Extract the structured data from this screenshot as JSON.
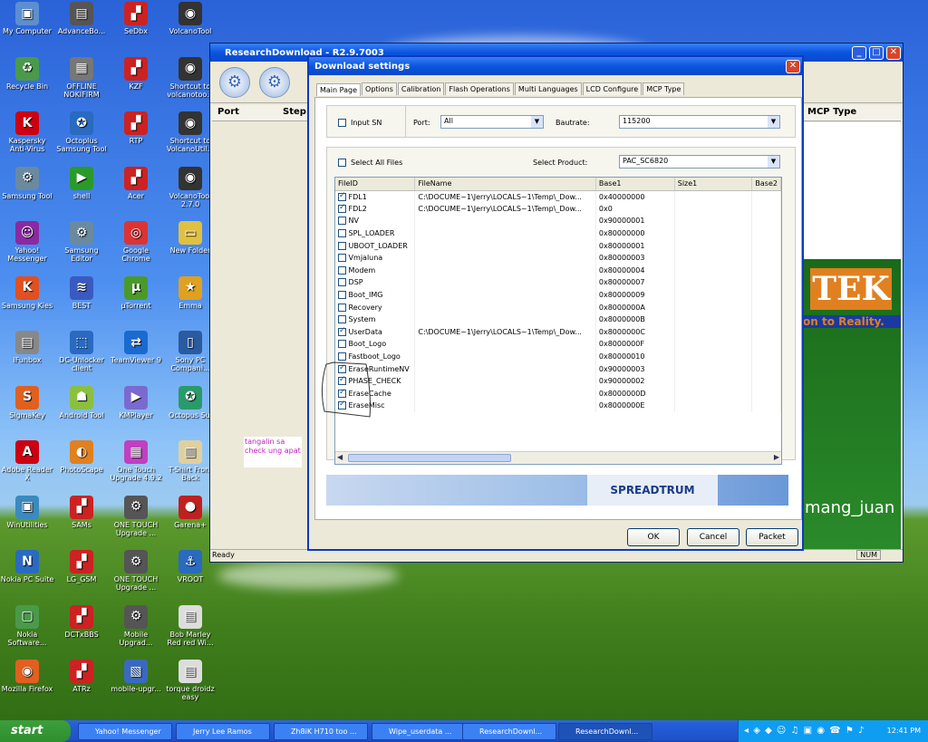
{
  "desktop": {
    "icons": [
      {
        "label": "My Computer",
        "color": "#5b8fd0",
        "glyph": "▣"
      },
      {
        "label": "AdvanceBo...",
        "color": "#555",
        "glyph": "▤"
      },
      {
        "label": "SeDbx",
        "color": "#c22",
        "glyph": "▞"
      },
      {
        "label": "VolcanoTool",
        "color": "#333",
        "glyph": "◉"
      },
      {
        "label": "Recycle Bin",
        "color": "#4a9a4a",
        "glyph": "♻"
      },
      {
        "label": "OFFLINE NOKIFIRM",
        "color": "#777",
        "glyph": "▦"
      },
      {
        "label": "KZF",
        "color": "#c22",
        "glyph": "▞"
      },
      {
        "label": "Shortcut to volcanotoo...",
        "color": "#333",
        "glyph": "◉"
      },
      {
        "label": "Kaspersky Anti-Virus",
        "color": "#c01",
        "glyph": "K"
      },
      {
        "label": "Octoplus Samsung Tool",
        "color": "#2a6ac0",
        "glyph": "✪"
      },
      {
        "label": "RTP",
        "color": "#c22",
        "glyph": "▞"
      },
      {
        "label": "Shortcut to VolcanoUtil...",
        "color": "#333",
        "glyph": "◉"
      },
      {
        "label": "Samsung Tool",
        "color": "#6a8aa0",
        "glyph": "⚙"
      },
      {
        "label": "shell",
        "color": "#2a9a2a",
        "glyph": "▶"
      },
      {
        "label": "Acer",
        "color": "#c22",
        "glyph": "▞"
      },
      {
        "label": "VolcanoTool 2.7.0",
        "color": "#333",
        "glyph": "◉"
      },
      {
        "label": "Yahoo! Messenger",
        "color": "#8a2aa0",
        "glyph": "☺"
      },
      {
        "label": "Samsung Editor",
        "color": "#6a8aa0",
        "glyph": "⚙"
      },
      {
        "label": "Google Chrome",
        "color": "#d33",
        "glyph": "◎"
      },
      {
        "label": "New Folder",
        "color": "#e0c040",
        "glyph": "▭"
      },
      {
        "label": "Samsung Kies",
        "color": "#e05020",
        "glyph": "K"
      },
      {
        "label": "BEST",
        "color": "#3a5ac0",
        "glyph": "≋"
      },
      {
        "label": "µTorrent",
        "color": "#4a9a2a",
        "glyph": "µ"
      },
      {
        "label": "Emma",
        "color": "#e0a020",
        "glyph": "★"
      },
      {
        "label": "iFunbox",
        "color": "#888",
        "glyph": "▤"
      },
      {
        "label": "DC-Unlocker client",
        "color": "#2a6ac0",
        "glyph": "⬚"
      },
      {
        "label": "TeamViewer 9",
        "color": "#1a6ad0",
        "glyph": "⇄"
      },
      {
        "label": "Sony PC Compani...",
        "color": "#2a5aa0",
        "glyph": "▯"
      },
      {
        "label": "SigmaKey",
        "color": "#e06020",
        "glyph": "S"
      },
      {
        "label": "Android Tool",
        "color": "#8ac040",
        "glyph": "☗"
      },
      {
        "label": "KMPlayer",
        "color": "#7a6ad0",
        "glyph": "▶"
      },
      {
        "label": "Octopus Sui",
        "color": "#2a9a6a",
        "glyph": "✪"
      },
      {
        "label": "Adobe Reader X",
        "color": "#c01",
        "glyph": "A"
      },
      {
        "label": "PhotoScape",
        "color": "#e08020",
        "glyph": "◐"
      },
      {
        "label": "One Touch Upgrade 4.9.2",
        "color": "#c040c0",
        "glyph": "▦"
      },
      {
        "label": "T-Shirt Front Back",
        "color": "#e0d0a0",
        "glyph": "▥"
      },
      {
        "label": "WinUtilities",
        "color": "#3a8ac0",
        "glyph": "▣"
      },
      {
        "label": "SAMs",
        "color": "#c22",
        "glyph": "▞"
      },
      {
        "label": "ONE TOUCH Upgrade ...",
        "color": "#555",
        "glyph": "⚙"
      },
      {
        "label": "Garena+",
        "color": "#c02020",
        "glyph": "●"
      },
      {
        "label": "Nokia PC Suite",
        "color": "#2a6ac0",
        "glyph": "N"
      },
      {
        "label": "LG_GSM",
        "color": "#c22",
        "glyph": "▞"
      },
      {
        "label": "ONE TOUCH Upgrade ...",
        "color": "#555",
        "glyph": "⚙"
      },
      {
        "label": "VROOT",
        "color": "#2a6ac0",
        "glyph": "⚓"
      },
      {
        "label": "Nokia Software...",
        "color": "#4a9a4a",
        "glyph": "▢"
      },
      {
        "label": "DCTxBBS",
        "color": "#c22",
        "glyph": "▞"
      },
      {
        "label": "Mobile Upgrad...",
        "color": "#555",
        "glyph": "⚙"
      },
      {
        "label": "Bob Marley Red red Wi...",
        "color": "#ddd",
        "glyph": "▤"
      },
      {
        "label": "Mozilla Firefox",
        "color": "#e06020",
        "glyph": "◉"
      },
      {
        "label": "ATRz",
        "color": "#c22",
        "glyph": "▞"
      },
      {
        "label": "mobile-upgr...",
        "color": "#3a6ac0",
        "glyph": "▧"
      },
      {
        "label": "torque droidz easy",
        "color": "#ddd",
        "glyph": "▤"
      }
    ]
  },
  "main_window": {
    "title": "ResearchDownload - R2.9.7003",
    "columns": {
      "port": "Port",
      "step": "Step",
      "mcp": "MCP Type"
    },
    "status": "Ready",
    "num": "NUM",
    "note": "tangalin sa check ung apat",
    "banner_text": "TEK",
    "banner_sub": "on to Reality.",
    "watermark": "mang_juan"
  },
  "dialog": {
    "title": "Download settings",
    "tabs": [
      "Main Page",
      "Options",
      "Calibration",
      "Flash Operations",
      "Multi Languages",
      "LCD Configure",
      "MCP Type"
    ],
    "input_sn": "Input SN",
    "port_label": "Port:",
    "port_value": "All",
    "baud_label": "Bautrate:",
    "baud_value": "115200",
    "select_all": "Select All Files",
    "product_label": "Select Product:",
    "product_value": "PAC_SC6820",
    "table": {
      "headers": [
        "FileID",
        "FileName",
        "Base1",
        "Size1",
        "Base2"
      ],
      "rows": [
        {
          "id": "FDL1",
          "checked": true,
          "file": "C:\\DOCUME~1\\Jerry\\LOCALS~1\\Temp\\_Dow...",
          "base": "0x40000000"
        },
        {
          "id": "FDL2",
          "checked": true,
          "file": "C:\\DOCUME~1\\Jerry\\LOCALS~1\\Temp\\_Dow...",
          "base": "0x0"
        },
        {
          "id": "NV",
          "checked": false,
          "file": "",
          "base": "0x90000001"
        },
        {
          "id": "SPL_LOADER",
          "checked": false,
          "file": "",
          "base": "0x80000000"
        },
        {
          "id": "UBOOT_LOADER",
          "checked": false,
          "file": "",
          "base": "0x80000001"
        },
        {
          "id": "Vmjaluna",
          "checked": false,
          "file": "",
          "base": "0x80000003"
        },
        {
          "id": "Modem",
          "checked": false,
          "file": "",
          "base": "0x80000004"
        },
        {
          "id": "DSP",
          "checked": false,
          "file": "",
          "base": "0x80000007"
        },
        {
          "id": "Boot_IMG",
          "checked": false,
          "file": "",
          "base": "0x80000009"
        },
        {
          "id": "Recovery",
          "checked": false,
          "file": "",
          "base": "0x8000000A"
        },
        {
          "id": "System",
          "checked": false,
          "file": "",
          "base": "0x8000000B"
        },
        {
          "id": "UserData",
          "checked": true,
          "file": "C:\\DOCUME~1\\Jerry\\LOCALS~1\\Temp\\_Dow...",
          "base": "0x8000000C"
        },
        {
          "id": "Boot_Logo",
          "checked": false,
          "file": "",
          "base": "0x8000000F"
        },
        {
          "id": "Fastboot_Logo",
          "checked": false,
          "file": "",
          "base": "0x80000010"
        },
        {
          "id": "EraseRuntimeNV",
          "checked": true,
          "file": "",
          "base": "0x90000003"
        },
        {
          "id": "PHASE_CHECK",
          "checked": true,
          "file": "",
          "base": "0x90000002"
        },
        {
          "id": "EraseCache",
          "checked": true,
          "file": "",
          "base": "0x8000000D"
        },
        {
          "id": "EraseMisc",
          "checked": true,
          "file": "",
          "base": "0x8000000E"
        }
      ]
    },
    "logo": "SPREADTRUM",
    "ok": "OK",
    "cancel": "Cancel",
    "packet": "Packet"
  },
  "taskbar": {
    "start": "start",
    "items": [
      "Yahoo! Messenger",
      "Jerry Lee Ramos",
      "Zh8iK H710 too ...",
      "Wipe_userdata ...",
      "ResearchDownl...",
      "ResearchDownl..."
    ],
    "clock": "12:41 PM"
  }
}
